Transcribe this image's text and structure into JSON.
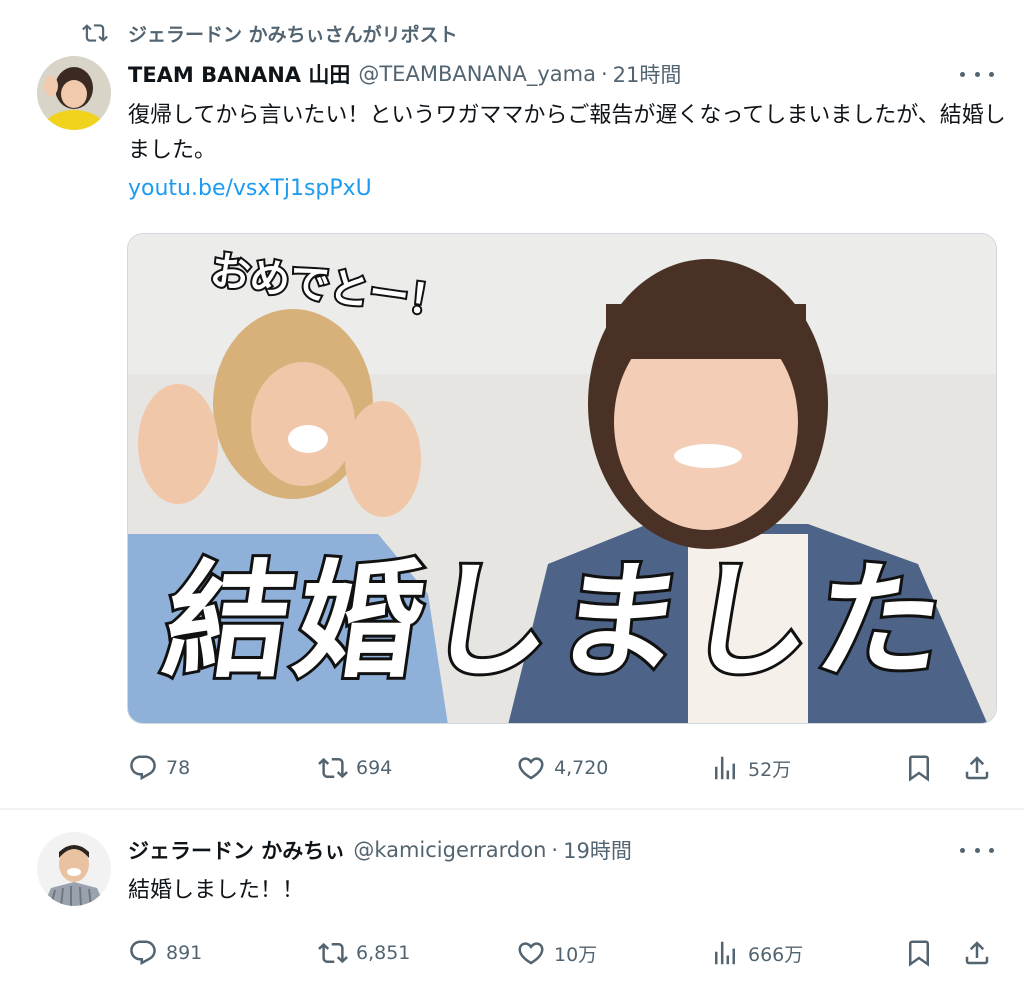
{
  "repost_banner": {
    "text": "ジェラードン かみちぃさんがリポスト",
    "icon": "repost-icon"
  },
  "tweets": [
    {
      "author_name": "TEAM BANANA 山田",
      "handle": "@TEAMBANANA_yama",
      "separator": "·",
      "time": "21時間",
      "text": "復帰してから言いたい！というワガママからご報告が遅くなってしまいましたが、結婚しました。",
      "link": "youtu.be/vsxTj1spPxU",
      "media": {
        "overlay_small": "おめでとー！",
        "overlay_big": "結婚しました"
      },
      "stats": {
        "replies": "78",
        "reposts": "694",
        "likes": "4,720",
        "views": "52万"
      }
    },
    {
      "author_name": "ジェラードン かみちぃ",
      "handle": "@kamicigerrardon",
      "separator": "·",
      "time": "19時間",
      "text": "結婚しました！！",
      "stats": {
        "replies": "891",
        "reposts": "6,851",
        "likes": "10万",
        "views": "666万"
      }
    }
  ],
  "colors": {
    "text": "#0f1419",
    "secondary": "#536471",
    "link": "#1d9bf0",
    "divider": "#eff3f4"
  }
}
